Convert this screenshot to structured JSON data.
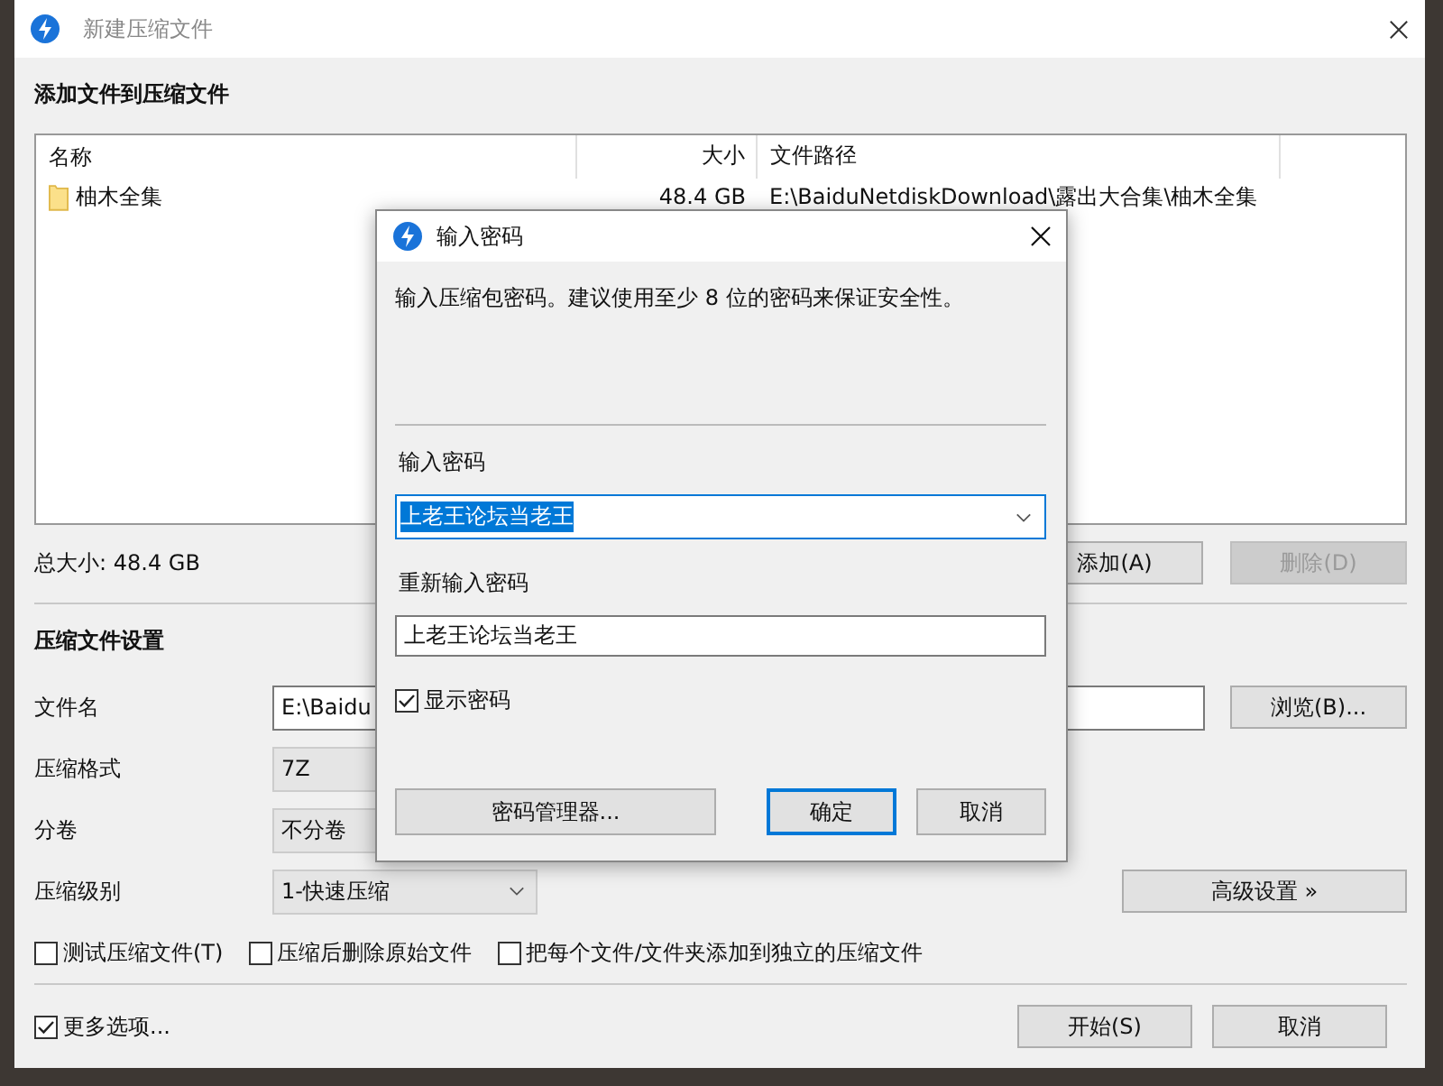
{
  "window": {
    "title": "新建压缩文件"
  },
  "add_section": {
    "heading": "添加文件到压缩文件",
    "table": {
      "columns": [
        "名称",
        "大小",
        "文件路径"
      ],
      "rows": [
        {
          "name": "柚木全集",
          "size": "48.4 GB",
          "path": "E:\\BaiduNetdiskDownload\\露出大合集\\柚木全集"
        }
      ]
    },
    "total": "总大小: 48.4 GB",
    "buttons": [
      {
        "label": "添加(A)",
        "disabled": false
      },
      {
        "label": "删除(D)",
        "disabled": true
      }
    ]
  },
  "settings": {
    "heading": "压缩文件设置",
    "fields": [
      {
        "label": "文件名",
        "kind": "text",
        "value": "E:\\Baidu"
      },
      {
        "label": "压缩格式",
        "kind": "select",
        "value": "7Z"
      },
      {
        "label": "分卷",
        "kind": "select",
        "value": "不分卷"
      },
      {
        "label": "压缩级别",
        "kind": "select",
        "value": "1-快速压缩"
      }
    ],
    "browse_button": "浏览(B)...",
    "advanced_button": "高级设置 »",
    "options": [
      {
        "label": "测试压缩文件(T)",
        "checked": false
      },
      {
        "label": "压缩后删除原始文件",
        "checked": false
      },
      {
        "label": "把每个文件/文件夹添加到独立的压缩文件",
        "checked": false
      }
    ]
  },
  "more_options": {
    "label": "更多选项...",
    "checked": true
  },
  "footer_buttons": [
    "开始(S)",
    "取消"
  ],
  "dialog": {
    "title": "输入密码",
    "message": "输入压缩包密码。建议使用至少 8 位的密码来保证安全性。",
    "password_label": "输入密码",
    "password_value": "上老王论坛当老王",
    "password_selected": true,
    "retype_label": "重新输入密码",
    "retype_value": "上老王论坛当老王",
    "show_password": {
      "label": "显示密码",
      "checked": true
    },
    "manager_button": "密码管理器...",
    "buttons": [
      {
        "label": "确定",
        "default": true
      },
      {
        "label": "取消",
        "default": false
      }
    ]
  }
}
